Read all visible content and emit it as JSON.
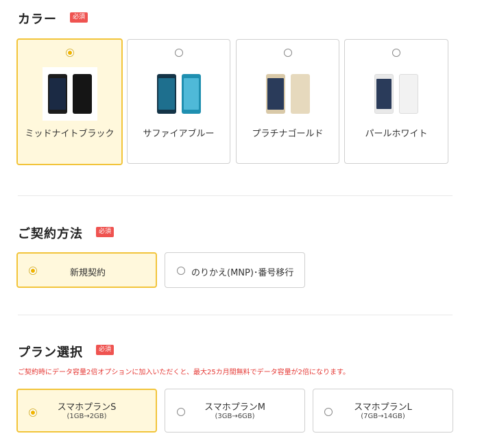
{
  "required_badge": "必須",
  "color_section": {
    "title": "カラー",
    "options": [
      {
        "label": "ミッドナイトブラック",
        "selected": true,
        "phone_colors": {
          "back": "#151515",
          "front": "#1c1c1c",
          "screen": "#1b2a44"
        }
      },
      {
        "label": "サファイアブルー",
        "selected": false,
        "phone_colors": {
          "back": "#1f8fb0",
          "front": "#143447",
          "screen": "#1e6f8e"
        }
      },
      {
        "label": "プラチナゴールド",
        "selected": false,
        "phone_colors": {
          "back": "#e6d9bd",
          "front": "#d9c9a8",
          "screen": "#2a3b5a"
        }
      },
      {
        "label": "パールホワイト",
        "selected": false,
        "phone_colors": {
          "back": "#f2f2f2",
          "front": "#e9e9e9",
          "screen": "#2a3b5a"
        }
      }
    ]
  },
  "contract_section": {
    "title": "ご契約方法",
    "options": [
      {
        "label": "新規契約",
        "selected": true
      },
      {
        "label": "のりかえ(MNP)･番号移行",
        "selected": false
      }
    ]
  },
  "plan_section": {
    "title": "プラン選択",
    "note": "ご契約時にデータ容量2倍オプションに加入いただくと、最大25カ月間無料でデータ容量が2倍になります。",
    "options": [
      {
        "name": "スマホプランS",
        "detail": "(1GB→2GB)",
        "selected": true
      },
      {
        "name": "スマホプランM",
        "detail": "(3GB→6GB)",
        "selected": false
      },
      {
        "name": "スマホプランL",
        "detail": "(7GB→14GB)",
        "selected": false
      }
    ]
  },
  "colors": {
    "accent_border": "#f2c43a",
    "accent_fill": "#fff8dc",
    "badge": "#ef5350",
    "note_text": "#e53935"
  }
}
